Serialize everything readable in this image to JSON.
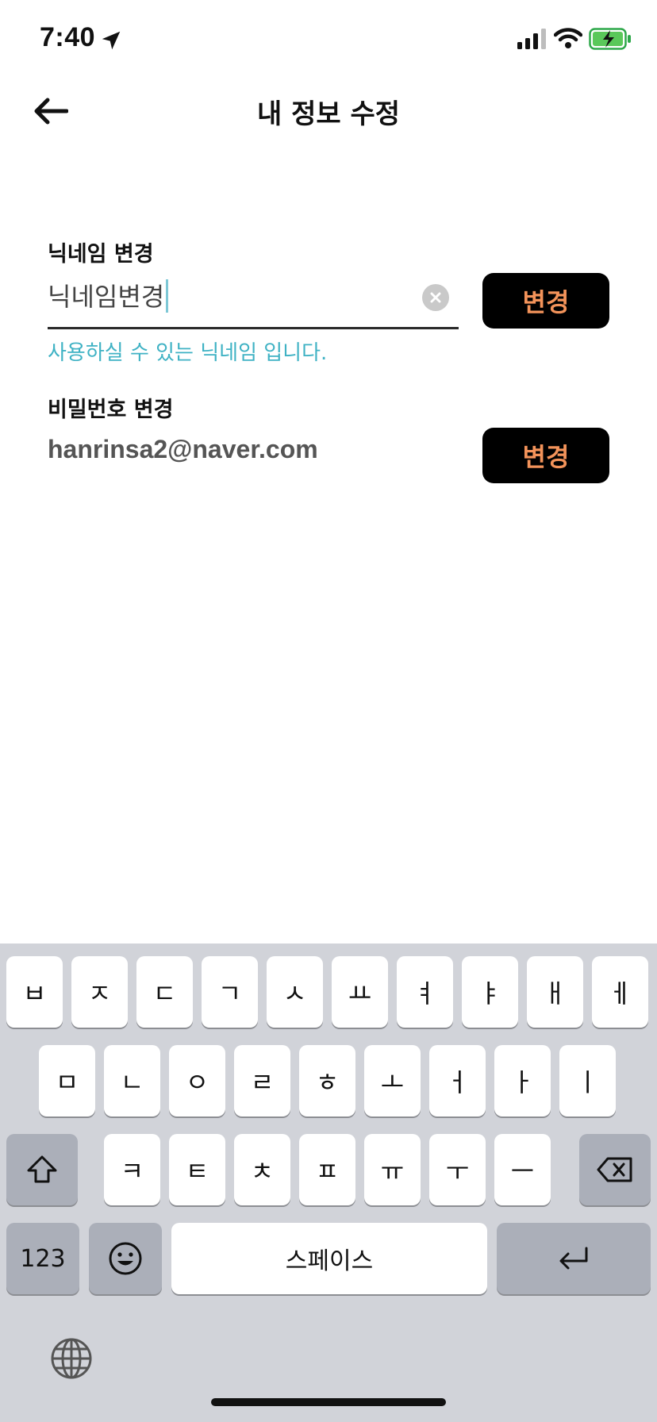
{
  "status_bar": {
    "time": "7:40"
  },
  "header": {
    "title": "내 정보 수정"
  },
  "nickname": {
    "label": "닉네임 변경",
    "value": "닉네임변경",
    "helper": "사용하실 수 있는 닉네임 입니다.",
    "button": "변경"
  },
  "password": {
    "label": "비밀번호 변경",
    "email": "hanrinsa2@naver.com",
    "button": "변경"
  },
  "keyboard": {
    "row1": [
      "ㅂ",
      "ㅈ",
      "ㄷ",
      "ㄱ",
      "ㅅ",
      "ㅛ",
      "ㅕ",
      "ㅑ",
      "ㅐ",
      "ㅔ"
    ],
    "row2": [
      "ㅁ",
      "ㄴ",
      "ㅇ",
      "ㄹ",
      "ㅎ",
      "ㅗ",
      "ㅓ",
      "ㅏ",
      "ㅣ"
    ],
    "row3": [
      "ㅋ",
      "ㅌ",
      "ㅊ",
      "ㅍ",
      "ㅠ",
      "ㅜ",
      "ㅡ"
    ],
    "numbers_label": "123",
    "space_label": "스페이스"
  },
  "colors": {
    "accent_orange": "#f3935a",
    "helper_teal": "#3fb2c4",
    "keyboard_bg": "#d1d3d9"
  }
}
